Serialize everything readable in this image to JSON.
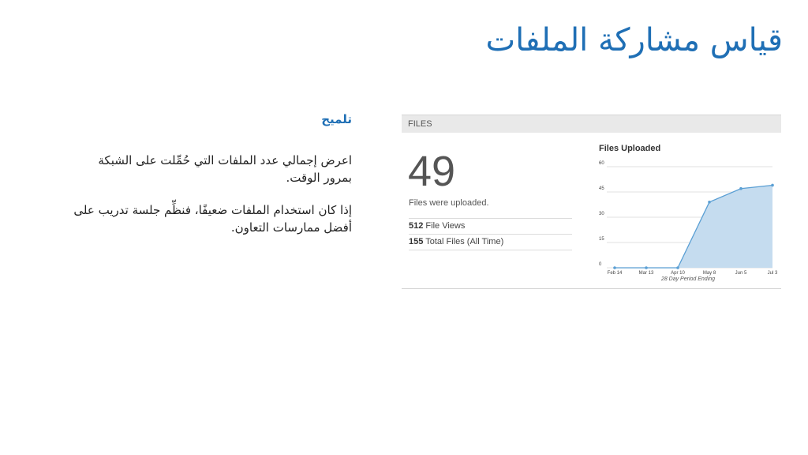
{
  "slide": {
    "title": "قياس مشاركة الملفات"
  },
  "tip": {
    "heading": "تلميح",
    "paragraphs": [
      "اعرض إجمالي عدد الملفات التي حُمِّلت على الشبكة بمرور الوقت.",
      "إذا كان استخدام الملفات ضعيفًا، فنظِّم جلسة تدريب على أفضل ممارسات التعاون."
    ]
  },
  "widget": {
    "header": "FILES",
    "big_number": "49",
    "caption": "Files were uploaded.",
    "stats": [
      {
        "value": "512",
        "label": "File Views"
      },
      {
        "value": "155",
        "label": "Total Files (All Time)"
      }
    ]
  },
  "colors": {
    "title_blue": "#1f6fb5",
    "area_fill": "#c5dcef",
    "line": "#5a9fd4"
  },
  "chart_data": {
    "type": "area",
    "title": "Files Uploaded",
    "xlabel": "28 Day Period Ending",
    "ylabel": "",
    "categories": [
      "Feb 14",
      "Mar 13",
      "Apr 10",
      "May 8",
      "Jun 5",
      "Jul 3"
    ],
    "values": [
      0,
      0,
      0,
      39,
      47,
      49
    ],
    "ylim": [
      0,
      60
    ],
    "yticks": [
      0,
      15,
      30,
      45,
      60
    ],
    "grid": true,
    "legend": "none"
  }
}
